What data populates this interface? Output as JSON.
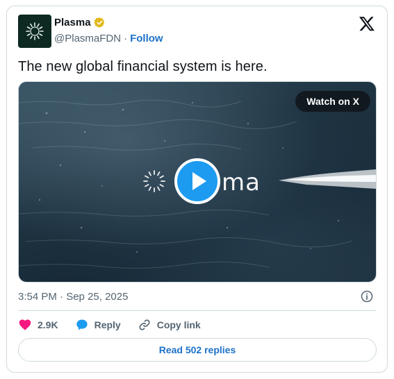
{
  "author": {
    "name": "Plasma",
    "handle": "@PlasmaFDN",
    "separator": "·",
    "follow_label": "Follow",
    "verified_color": "#e2b719"
  },
  "tweet": {
    "text": "The new global financial system is here."
  },
  "media": {
    "watch_label": "Watch on X",
    "brand_text": "ma",
    "play_color": "#1d9bf0"
  },
  "meta": {
    "timestamp": "3:54 PM · Sep 25, 2025"
  },
  "actions": {
    "like_count": "2.9K",
    "reply_label": "Reply",
    "copy_link_label": "Copy link",
    "like_color": "#f91880",
    "reply_color": "#1d9bf0"
  },
  "footer": {
    "read_replies_label": "Read 502 replies"
  }
}
